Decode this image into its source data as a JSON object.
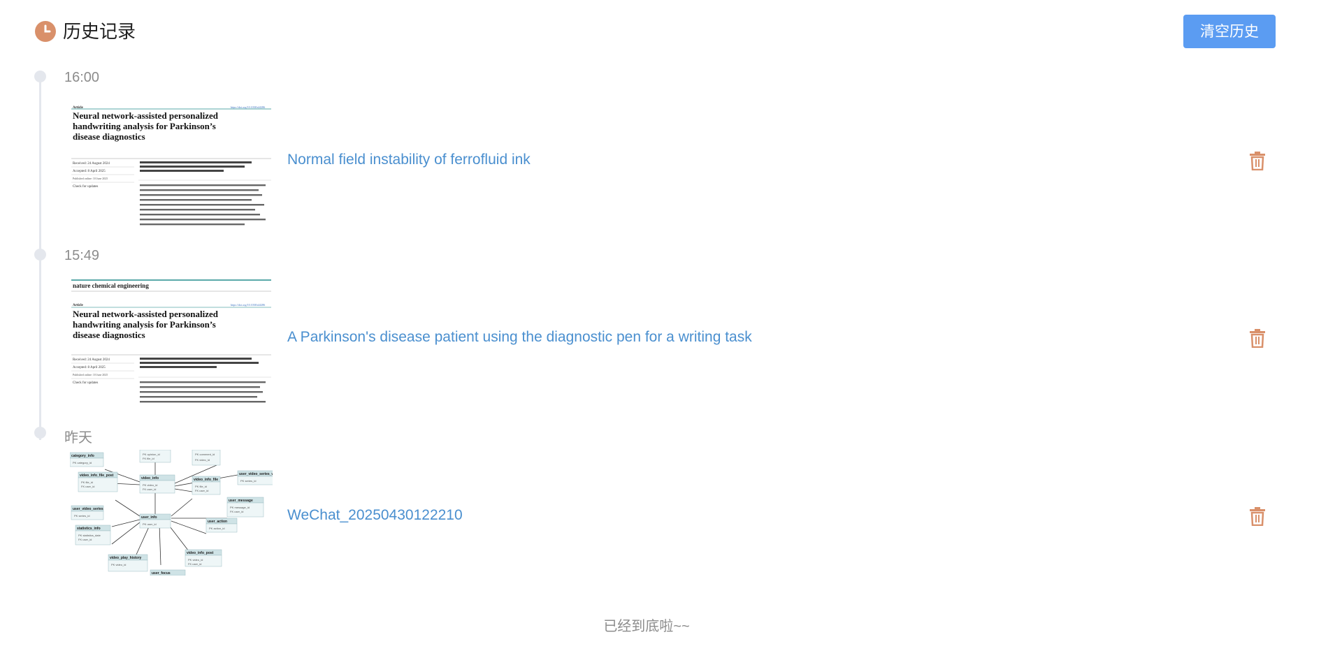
{
  "header": {
    "title": "历史记录",
    "clear_button": "清空历史",
    "icon": "clock-icon",
    "accent_color": "#d9906a",
    "button_color": "#5b9cf2"
  },
  "entries": [
    {
      "time": "16:00",
      "title": "Normal field instability of ferrofluid ink",
      "thumb": {
        "journal": "",
        "label": "Article",
        "headline": [
          "Neural network-assisted personalized",
          "handwriting analysis for Parkinson’s",
          "disease diagnostics"
        ],
        "meta": [
          "Received: 24 August 2024",
          "Accepted: 8 April 2025",
          "Published online: 10 June 2025",
          "Check for updates"
        ]
      }
    },
    {
      "time": "15:49",
      "title": "A Parkinson's disease patient using the diagnostic pen for a writing task",
      "thumb": {
        "journal": "nature chemical engineering",
        "label": "Article",
        "headline": [
          "Neural network-assisted personalized",
          "handwriting analysis for Parkinson’s",
          "disease diagnostics"
        ],
        "meta": [
          "Received: 24 August 2024",
          "Accepted: 8 April 2025",
          "Published online: 10 June 2025",
          "Check for updates"
        ]
      }
    },
    {
      "time": "昨天",
      "title": "WeChat_20250430122210",
      "thumb": {
        "tables": [
          "category_info",
          "video_info_file_post",
          "video_info",
          "video_info_file",
          "user_video_series_video",
          "user_video_series",
          "user_info",
          "user_message",
          "statistics_info",
          "user_action",
          "video_play_history",
          "video_info_post",
          "user_focus"
        ]
      }
    }
  ],
  "footer": "已经到底啦~~"
}
